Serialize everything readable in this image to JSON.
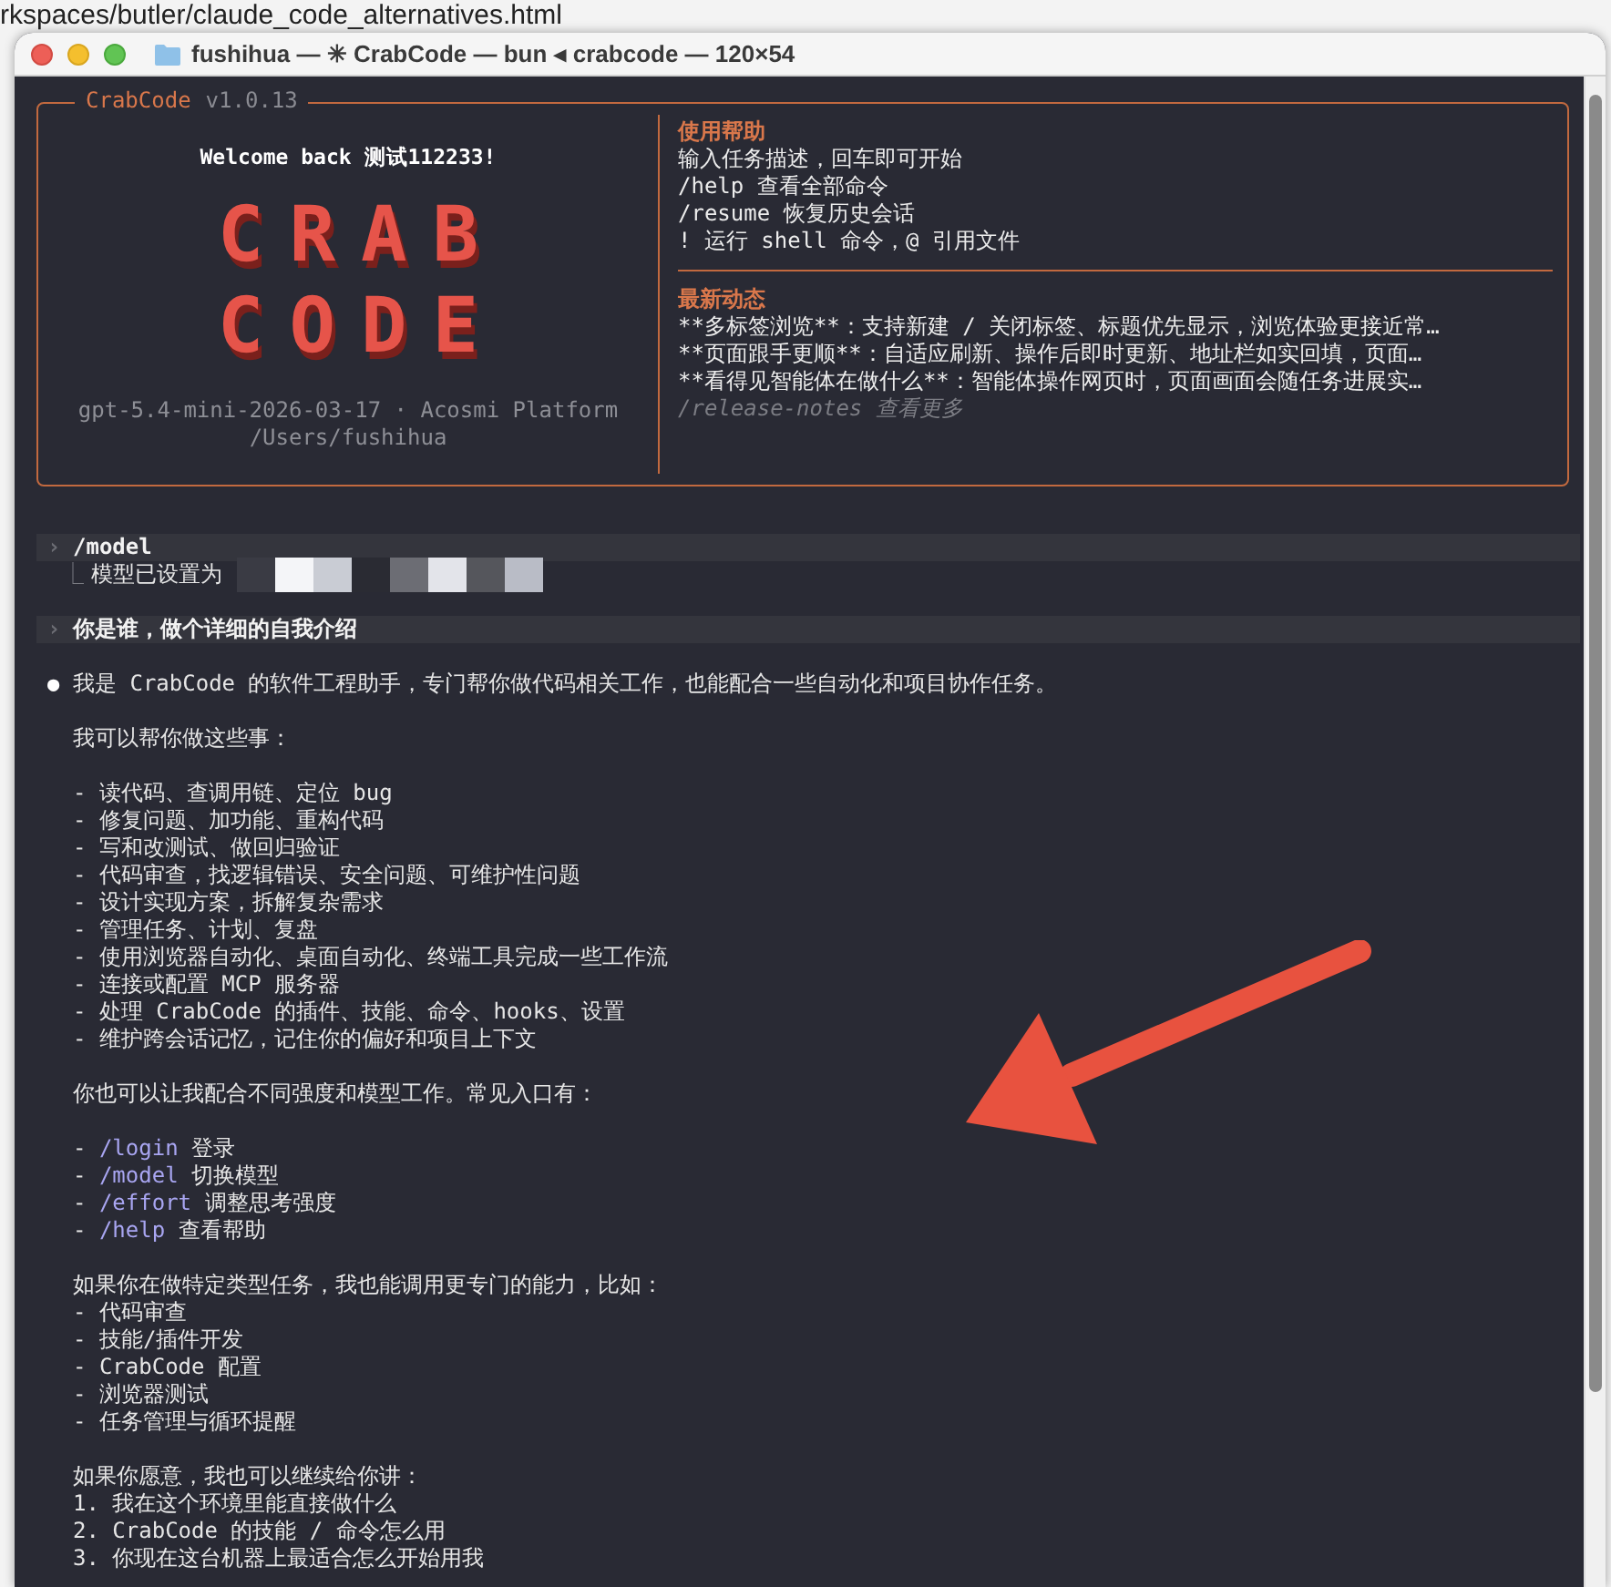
{
  "browser_background": {
    "url_fragment": "rkspaces/butler/claude_code_alternatives.html"
  },
  "window": {
    "title": "fushihua — ✳ CrabCode — bun ◂ crabcode — 120×54"
  },
  "banner": {
    "title": "CrabCode",
    "version": "v1.0.13",
    "welcome": "Welcome back 测试112233!",
    "logo_lines": [
      "CRAB",
      "CODE"
    ],
    "model_info": "gpt-5.4-mini-2026-03-17 · Acosmi Platform",
    "cwd": "/Users/fushihua",
    "sections": [
      {
        "heading": "使用帮助",
        "lines": [
          {
            "text": "输入任务描述，回车即可开始",
            "muted": false
          },
          {
            "text": "/help 查看全部命令",
            "muted": false
          },
          {
            "text": "/resume 恢复历史会话",
            "muted": false
          },
          {
            "text": "! 运行 shell 命令，@ 引用文件",
            "muted": false
          }
        ]
      },
      {
        "heading": "最新动态",
        "lines": [
          {
            "text": "**多标签浏览**：支持新建 / 关闭标签、标题优先显示，浏览体验更接近常…",
            "muted": false
          },
          {
            "text": "**页面跟手更顺**：自适应刷新、操作后即时更新、地址栏如实回填，页面…",
            "muted": false
          },
          {
            "text": "**看得见智能体在做什么**：智能体操作网页时，页面画面会随任务进展实…",
            "muted": false
          },
          {
            "text": "/release-notes 查看更多",
            "muted": true
          }
        ]
      }
    ]
  },
  "transcript": [
    {
      "kind": "prompt",
      "marker": "›",
      "text": "/model"
    },
    {
      "kind": "result",
      "marker": "⎿",
      "text": "模型已设置为",
      "redacted": true
    },
    {
      "kind": "prompt",
      "marker": "›",
      "text": "你是谁，做个详细的自我介绍"
    },
    {
      "kind": "reply",
      "marker": "●",
      "paragraphs": [
        [
          {
            "text": "我是 CrabCode 的软件工程助手，专门帮你做代码相关工作，也能配合一些自动化和项目协作任务。"
          }
        ],
        [
          {
            "text": "我可以帮你做这些事："
          }
        ],
        [
          {
            "text": "- 读代码、查调用链、定位 bug"
          },
          {
            "text": "- 修复问题、加功能、重构代码"
          },
          {
            "text": "- 写和改测试、做回归验证"
          },
          {
            "text": "- 代码审查，找逻辑错误、安全问题、可维护性问题"
          },
          {
            "text": "- 设计实现方案，拆解复杂需求"
          },
          {
            "text": "- 管理任务、计划、复盘"
          },
          {
            "text": "- 使用浏览器自动化、桌面自动化、终端工具完成一些工作流"
          },
          {
            "text": "- 连接或配置 MCP 服务器"
          },
          {
            "text": "- 处理 CrabCode 的插件、技能、命令、hooks、设置"
          },
          {
            "text": "- 维护跨会话记忆，记住你的偏好和项目上下文"
          }
        ],
        [
          {
            "text": "你也可以让我配合不同强度和模型工作。常见入口有："
          }
        ],
        [
          {
            "prefix": "- ",
            "command": "/login",
            "text": "登录"
          },
          {
            "prefix": "- ",
            "command": "/model",
            "text": "切换模型"
          },
          {
            "prefix": "- ",
            "command": "/effort",
            "text": "调整思考强度"
          },
          {
            "prefix": "- ",
            "command": "/help",
            "text": "查看帮助"
          }
        ],
        [
          {
            "text": "如果你在做特定类型任务，我也能调用更专门的能力，比如："
          },
          {
            "text": "- 代码审查"
          },
          {
            "text": "- 技能/插件开发"
          },
          {
            "text": "- CrabCode 配置"
          },
          {
            "text": "- 浏览器测试"
          },
          {
            "text": "- 任务管理与循环提醒"
          }
        ],
        [
          {
            "text": "如果你愿意，我也可以继续给你讲："
          },
          {
            "text": "1. 我在这个环境里能直接做什么"
          },
          {
            "text": "2. CrabCode 的技能 / 命令怎么用"
          },
          {
            "text": "3. 你现在这台机器上最适合怎么开始用我"
          }
        ]
      ]
    }
  ]
}
